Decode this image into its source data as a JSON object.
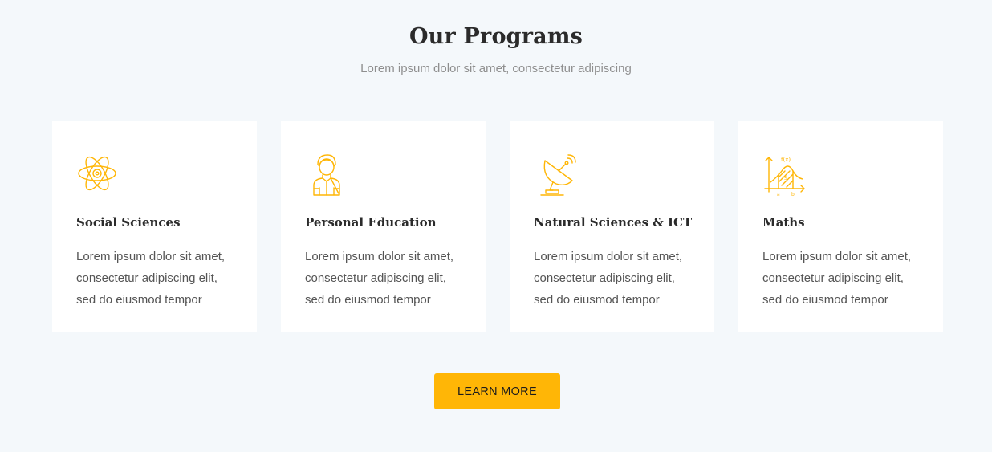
{
  "section": {
    "title": "Our Programs",
    "subtitle": "Lorem ipsum dolor sit amet, consectetur adipiscing"
  },
  "accent_color": "#ffb606",
  "cards": [
    {
      "icon": "atom-icon",
      "title": "Social Sciences",
      "lines": [
        "Lorem ipsum dolor sit amet,",
        "consectetur adipiscing elit,",
        "sed do eiusmod tempor"
      ]
    },
    {
      "icon": "person-icon",
      "title": "Personal Education",
      "lines": [
        "Lorem ipsum dolor sit amet,",
        "consectetur adipiscing elit,",
        "sed do eiusmod tempor"
      ]
    },
    {
      "icon": "satellite-dish-icon",
      "title": "Natural Sciences & ICT",
      "lines": [
        "Lorem ipsum dolor sit amet,",
        "consectetur adipiscing elit,",
        "sed do eiusmod tempor"
      ]
    },
    {
      "icon": "function-graph-icon",
      "title": "Maths",
      "icon_labels": [
        "f(x)",
        "S",
        "a",
        "b"
      ],
      "lines": [
        "Lorem ipsum dolor sit amet,",
        "consectetur adipiscing elit,",
        "sed do eiusmod tempor"
      ]
    }
  ],
  "button": {
    "label": "LEARN MORE"
  }
}
